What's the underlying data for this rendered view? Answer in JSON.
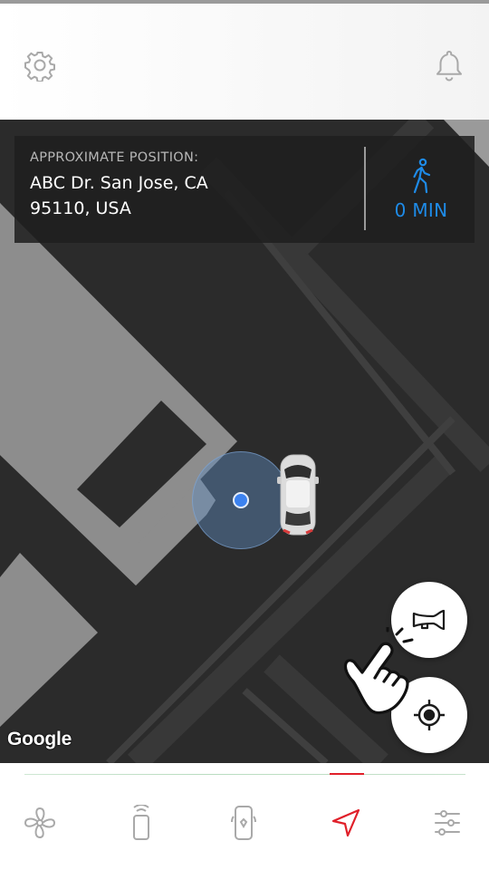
{
  "header": {
    "settings_icon": "gear-icon",
    "notifications_icon": "bell-icon"
  },
  "map": {
    "info_panel": {
      "caption": "APPROXIMATE POSITION:",
      "address_line1": "ABC Dr. San Jose, CA",
      "address_line2": "95110, USA",
      "walk_icon": "walking-person-icon",
      "walk_time": "0 MIN"
    },
    "attribution": "Google",
    "horn_icon": "horn-icon",
    "locate_icon": "crosshair-icon"
  },
  "bottom_nav": {
    "tabs": [
      {
        "icon": "fan-icon",
        "active": false
      },
      {
        "icon": "key-fob-icon",
        "active": false
      },
      {
        "icon": "phone-key-icon",
        "active": false
      },
      {
        "icon": "navigation-arrow-icon",
        "active": true
      },
      {
        "icon": "sliders-icon",
        "active": false
      }
    ]
  },
  "colors": {
    "accent_blue": "#1e8be8",
    "active_red": "#e0202a",
    "map_background": "#2b2b2b",
    "building_gray": "#8d8d8d"
  }
}
